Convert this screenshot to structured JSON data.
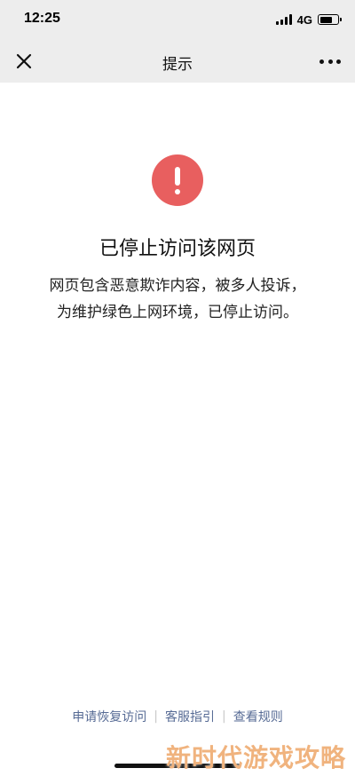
{
  "status_bar": {
    "time": "12:25",
    "network": "4G",
    "battery_level": 0.7
  },
  "nav": {
    "title": "提示",
    "close_icon": "close-icon",
    "more_icon": "more-icon"
  },
  "content": {
    "icon": "exclamation-icon",
    "icon_color": "#e85f5f",
    "title": "已停止访问该网页",
    "description_line1": "网页包含恶意欺诈内容，被多人投诉，",
    "description_line2": "为维护绿色上网环境，已停止访问。"
  },
  "footer": {
    "links": [
      "申请恢复访问",
      "客服指引",
      "查看规则"
    ],
    "link_color": "#576b95"
  },
  "watermark": "新时代游戏攻略"
}
